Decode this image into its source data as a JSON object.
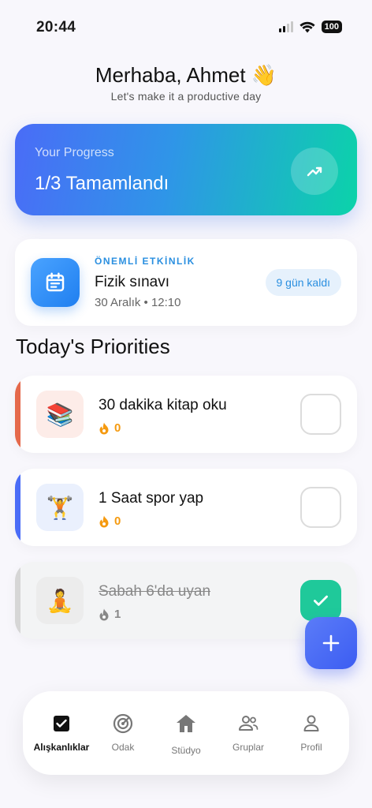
{
  "status": {
    "time": "20:44",
    "battery": "100"
  },
  "header": {
    "greeting": "Merhaba, Ahmet 👋",
    "subtitle": "Let's make it a productive day"
  },
  "progress": {
    "label": "Your Progress",
    "value": "1/3 Tamamlandı"
  },
  "event": {
    "tag": "ÖNEMLİ ETKİNLİK",
    "title": "Fizik sınavı",
    "date": "30 Aralık • 12:10",
    "badge": "9 gün kaldı"
  },
  "priorities": {
    "title": "Today's Priorities",
    "items": [
      {
        "emoji": "📚",
        "title": "30 dakika kitap oku",
        "streak": "0",
        "done": false,
        "accent": "#e5694b",
        "tint": "#fdece8"
      },
      {
        "emoji": "🏋️",
        "title": "1 Saat spor yap",
        "streak": "0",
        "done": false,
        "accent": "#4a6cf7",
        "tint": "#eaf0fd"
      },
      {
        "emoji": "🧘",
        "title": "Sabah 6'da uyan",
        "streak": "1",
        "done": true,
        "accent": "#d6d6d6",
        "tint": "#ececec"
      }
    ]
  },
  "nav": {
    "items": [
      {
        "label": "Alışkanlıklar",
        "icon": "checkbox-icon",
        "active": true
      },
      {
        "label": "Odak",
        "icon": "target-icon",
        "active": false
      },
      {
        "label": "Stüdyo",
        "icon": "home-icon",
        "active": false
      },
      {
        "label": "Gruplar",
        "icon": "group-icon",
        "active": false
      },
      {
        "label": "Profil",
        "icon": "person-icon",
        "active": false
      }
    ]
  },
  "colors": {
    "accent": "#4a6cf7",
    "success": "#1fc99a",
    "streak": "#f59a10",
    "eventBlue": "#2a8fe0"
  }
}
